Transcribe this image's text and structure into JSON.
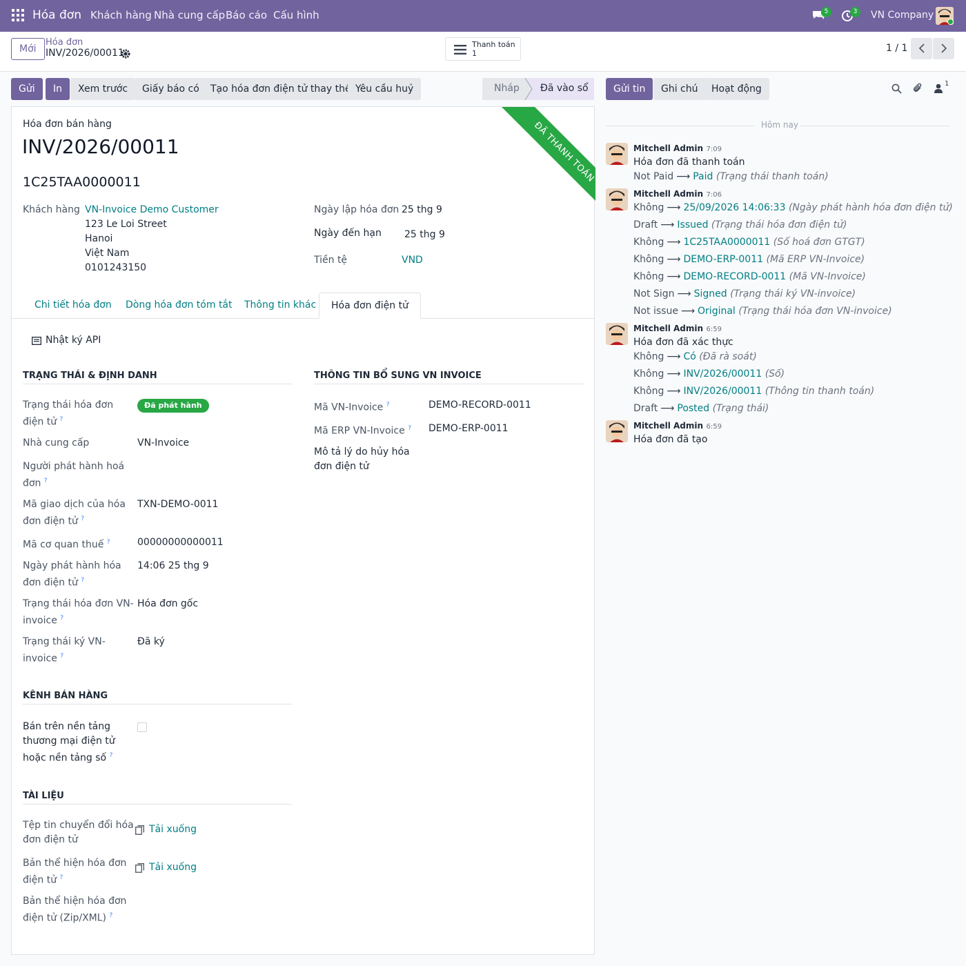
{
  "nav": {
    "app": "Hóa đơn",
    "menu": [
      "Khách hàng",
      "Nhà cung cấp",
      "Báo cáo",
      "Cấu hình"
    ],
    "msg_count": "5",
    "activity_count": "3",
    "company": "VN Company"
  },
  "cp": {
    "new": "Mới",
    "breadcrumb": "Hóa đơn",
    "record": "INV/2026/00011",
    "smart_label": "Thanh toán",
    "smart_count": "1",
    "pager": "1 / 1"
  },
  "actions": [
    "Gửi",
    "In",
    "Xem trước",
    "Giấy báo có",
    "Tạo hóa đơn điện tử thay thế",
    "Yêu cầu huỷ"
  ],
  "status": {
    "draft": "Nháp",
    "posted": "Đã vào sổ"
  },
  "chatter_btns": {
    "send": "Gửi tin",
    "note": "Ghi chú",
    "activity": "Hoạt động",
    "followers": "1"
  },
  "invoice": {
    "type": "Hóa đơn bán hàng",
    "number": "INV/2026/00011",
    "ribbon": "ĐÃ THANH TOÁN",
    "einv_number": "1C25TAA0000011",
    "customer_label": "Khách hàng",
    "customer": "VN-Invoice Demo Customer",
    "addr": [
      "123 Le Loi Street",
      "Hanoi",
      "Việt Nam",
      "0101243150"
    ],
    "date_label": "Ngày lập hóa đơn",
    "date": "25 thg 9",
    "due_label": "Ngày đến hạn",
    "due": "25 thg 9",
    "currency_label": "Tiền tệ",
    "currency": "VND"
  },
  "tabs": [
    "Chi tiết hóa đơn",
    "Dòng hóa đơn tóm tắt",
    "Thông tin khác",
    "Hóa đơn điện tử"
  ],
  "api_log": "Nhật ký API",
  "left_sect": "TRẠNG THÁI & ĐỊNH DANH",
  "left_fields": [
    {
      "l1": "Trạng thái hóa đơn",
      "l2": "điện tử",
      "v": ""
    },
    {
      "l1": "Nhà cung cấp",
      "l2": "",
      "v": "VN-Invoice"
    },
    {
      "l1": "Người phát hành hoá",
      "l2": "đơn",
      "v": ""
    },
    {
      "l1": "Mã giao dịch của hóa",
      "l2": "đơn điện tử",
      "v": "TXN-DEMO-0011"
    },
    {
      "l1": "Mã cơ quan thuế",
      "l2": "",
      "v": "00000000000011"
    },
    {
      "l1": "Ngày phát hành hóa",
      "l2": "đơn điện tử",
      "v": "14:06 25 thg 9"
    },
    {
      "l1": "Trạng thái hóa đơn VN-",
      "l2": "invoice",
      "v": "Hóa đơn gốc"
    },
    {
      "l1": "Trạng thái ký VN-",
      "l2": "invoice",
      "v": "Đã ký"
    }
  ],
  "issued_badge": "Đã phát hành",
  "right_sect": "THÔNG TIN BỔ SUNG VN INVOICE",
  "right_fields": [
    {
      "l": "Mã VN-Invoice",
      "v": "DEMO-RECORD-0011"
    },
    {
      "l": "Mã ERP VN-Invoice",
      "v": "DEMO-ERP-0011"
    }
  ],
  "cancel_l1": "Mô tả lý do hủy hóa",
  "cancel_l2": "đơn điện tử",
  "sales_sect": "KÊNH BÁN HÀNG",
  "ecom": [
    "Bán trên nền tảng",
    "thương mại điện tử",
    "hoặc nền tảng số"
  ],
  "docs_sect": "TÀI LIỆU",
  "docs": [
    {
      "l1": "Tệp tin chuyển đổi hóa",
      "l2": "đơn điện tử",
      "v": "Tải xuống"
    },
    {
      "l1": "Bản thể hiện hóa đơn",
      "l2": "điện tử",
      "v": "Tải xuống"
    },
    {
      "l1": "Bản thể hiện hóa đơn",
      "l2": "điện tử (Zip/XML)",
      "v": ""
    }
  ],
  "chatter": {
    "today": "Hôm nay",
    "author": "Mitchell Admin",
    "msgs": [
      {
        "time": "7:09",
        "body": "Hóa đơn đã thanh toán",
        "tracks": [
          {
            "o": "Not Paid",
            "n": "Paid",
            "f": "(Trạng thái thanh toán)"
          }
        ]
      },
      {
        "time": "7:06",
        "body": "",
        "tracks": [
          {
            "o": "Không",
            "n": "25/09/2026 14:06:33",
            "f": "(Ngày phát hành hóa đơn điện tử)"
          },
          {
            "o": "Draft",
            "n": "Issued",
            "f": "(Trạng thái hóa đơn điện tử)"
          },
          {
            "o": "Không",
            "n": "1C25TAA0000011",
            "f": "(Số hoá đơn GTGT)"
          },
          {
            "o": "Không",
            "n": "DEMO-ERP-0011",
            "f": "(Mã ERP VN-Invoice)"
          },
          {
            "o": "Không",
            "n": "DEMO-RECORD-0011",
            "f": "(Mã VN-Invoice)"
          },
          {
            "o": "Not Sign",
            "n": "Signed",
            "f": "(Trạng thái ký VN-invoice)"
          },
          {
            "o": "Not issue",
            "n": "Original",
            "f": "(Trạng thái hóa đơn VN-invoice)"
          }
        ]
      },
      {
        "time": "6:59",
        "body": "Hóa đơn đã xác thực",
        "tracks": [
          {
            "o": "Không",
            "n": "Có",
            "f": "(Đã rà soát)"
          },
          {
            "o": "Không",
            "n": "INV/2026/00011",
            "f": "(Số)"
          },
          {
            "o": "Không",
            "n": "INV/2026/00011",
            "f": "(Thông tin thanh toán)"
          },
          {
            "o": "Draft",
            "n": "Posted",
            "f": "(Trạng thái)"
          }
        ]
      },
      {
        "time": "6:59",
        "body": "Hóa đơn đã tạo",
        "tracks": []
      }
    ]
  }
}
